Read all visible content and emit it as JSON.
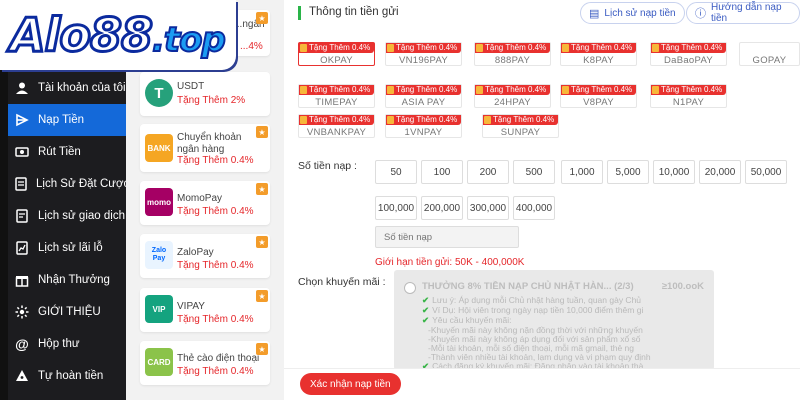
{
  "colors": {
    "accent": "#1469d9",
    "bonus_red": "#e5262a",
    "sidebar_bg": "#1c1c1f",
    "tag_red": "#e8312f"
  },
  "logo": {
    "text_main": "Alo88",
    "text_tld": ".top"
  },
  "sidebar": {
    "items": [
      {
        "label": "Tài khoản của tôi",
        "icon": "user-icon",
        "active": false
      },
      {
        "label": "Nạp Tiền",
        "icon": "deposit-icon",
        "active": true
      },
      {
        "label": "Rút Tiền",
        "icon": "withdraw-icon",
        "active": false
      },
      {
        "label": "Lịch Sử Đặt Cược",
        "icon": "bet-history-icon",
        "active": false
      },
      {
        "label": "Lịch sử giao dịch",
        "icon": "transaction-history-icon",
        "active": false
      },
      {
        "label": "Lịch sử lãi lỗ",
        "icon": "profit-loss-icon",
        "active": false
      },
      {
        "label": "Nhận Thưởng",
        "icon": "reward-icon",
        "active": false
      },
      {
        "label": "GIỚI THIỆU",
        "icon": "referral-icon",
        "active": false
      },
      {
        "label": "Hộp thư",
        "icon": "mail-icon",
        "active": false
      },
      {
        "label": "Tự hoàn tiền",
        "icon": "cashback-icon",
        "active": false
      }
    ]
  },
  "methods": [
    {
      "name": "...ngân",
      "bonus": "...4%"
    },
    {
      "name": "USDT",
      "bonus": "Tặng Thêm 2%"
    },
    {
      "name": "Chuyển khoản ngân hàng",
      "bonus": "Tặng Thêm 0.4%"
    },
    {
      "name": "MomoPay",
      "bonus": "Tặng Thêm 0.4%"
    },
    {
      "name": "ZaloPay",
      "bonus": "Tặng Thêm 0.4%"
    },
    {
      "name": "VIPAY",
      "bonus": "Tặng Thêm 0.4%"
    },
    {
      "name": "Thẻ cào điện thoại",
      "bonus": "Tặng Thêm 0.4%"
    }
  ],
  "method_logos": [
    "BANK",
    "T",
    "BANK",
    "momo",
    "Zalo Pay",
    "VIP",
    "CARD"
  ],
  "header": {
    "title": "Thông tin tiền gửi",
    "history_button": "Lịch sử nạp tiền",
    "guide_button": "Hướng dẫn nạp tiền"
  },
  "gateways": {
    "tag": "Tặng Thêm 0.4%",
    "row1": [
      "OKPAY",
      "VN196PAY",
      "888PAY",
      "K8PAY",
      "DaBaoPAY",
      "GOPAY"
    ],
    "row2": [
      "TIMEPAY",
      "ASIA PAY",
      "24HPAY",
      "V8PAY",
      "N1PAY"
    ],
    "row3": [
      "VNBANKPAY",
      "1VNPAY",
      "SUNPAY"
    ]
  },
  "amount": {
    "label": "Số tiền nạp :",
    "row1": [
      "50",
      "100",
      "200",
      "500",
      "1,000",
      "5,000",
      "10,000",
      "20,000",
      "50,000"
    ],
    "row2": [
      "100,000",
      "200,000",
      "300,000",
      "400,000"
    ],
    "placeholder": "Số tiền nạp",
    "limit": "Giới hạn tiền gửi:   50K  -  400,000K"
  },
  "promo": {
    "label": "Chọn khuyến mãi :",
    "title": "THƯỞNG 8% TIỀN NẠP CHỦ NHẬT HÀN...  (2/3)",
    "amount": "≥100.ooK",
    "lines": [
      "Lưu ý: Áp dụng mỗi Chủ nhật hàng tuần, quan gày Chủ",
      "Ví Dụ: Hội viên trong ngày nạp tiền 10,000 điểm thêm gi",
      "Yêu cầu khuyến mãi:",
      "-Khuyến mãi này không nặn đồng thời với những khuyến",
      "-Khuyến mãi này không áp dụng đối với sản phẩm xổ số",
      "-Mỗi tài khoản, mỗi số điện thoại, mỗi mã gmail, thẻ ng",
      "-Thành viên nhiều tài khoản, lạm dụng và vi phạm quy định",
      "Cách đăng ký khuyến mãi: Đăng nhập vào tài khoản thà"
    ]
  },
  "submit_label": "Xác nhận nạp tiền"
}
